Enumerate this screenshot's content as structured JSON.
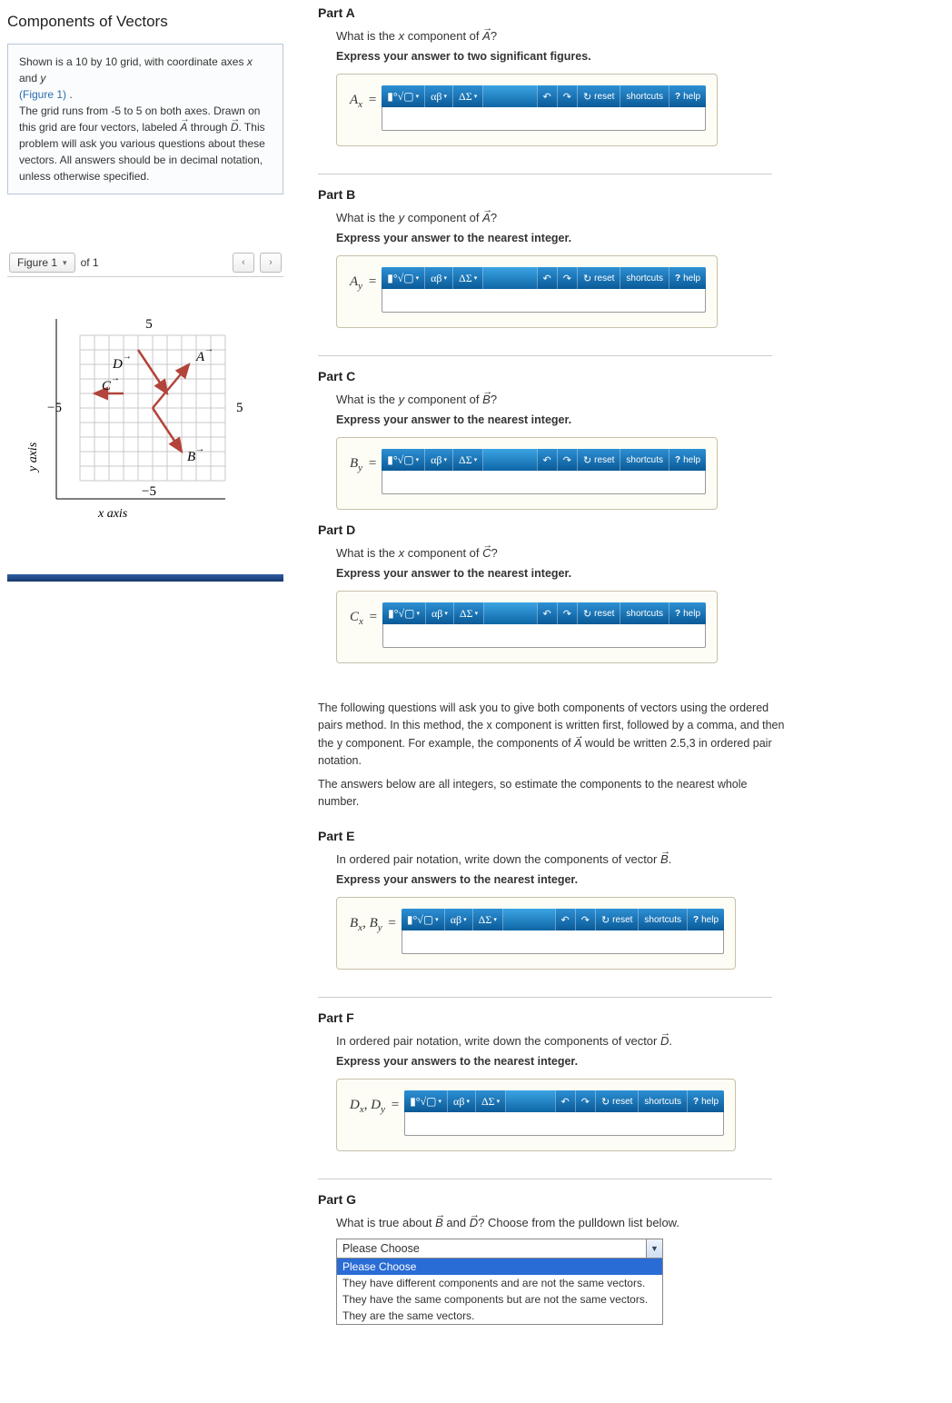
{
  "left": {
    "title": "Components of Vectors",
    "intro_p1a": "Shown is a 10 by 10 grid, with coordinate axes ",
    "intro_p1b": " and ",
    "intro_x": "x",
    "intro_y": "y",
    "figure_link": "(Figure 1)",
    "intro_p2a": "The grid runs from -5 to 5 on both axes. Drawn on this grid are four vectors, labeled ",
    "intro_p2b": " through ",
    "intro_p2c": ". This problem will ask you various questions about these vectors. All answers should be in decimal notation, unless otherwise specified.",
    "vecA": "A",
    "vecD": "D",
    "figure_selector": "Figure 1",
    "of_label": "of 1",
    "axis_x": "x axis",
    "axis_y": "y axis",
    "tick_neg5": "−5",
    "tick_5": "5",
    "lblA": "A",
    "lblB": "B",
    "lblC": "C",
    "lblD": "D"
  },
  "toolbar": {
    "t1": "▮°√▢",
    "t2": "αβ",
    "t3": "ΔΣ",
    "undo": "↶",
    "redo": "↷",
    "refresh": "↻",
    "reset": "reset",
    "shortcuts": "shortcuts",
    "help": "help",
    "qmark": "?"
  },
  "parts": {
    "A": {
      "title": "Part A",
      "q_pre": "What is the ",
      "q_var": "x",
      "q_mid": " component of ",
      "q_vec": "A",
      "q_post": "?",
      "hint": "Express your answer to two significant figures.",
      "lhs_main": "A",
      "lhs_sub": "x"
    },
    "B": {
      "title": "Part B",
      "q_pre": "What is the ",
      "q_var": "y",
      "q_mid": " component of ",
      "q_vec": "A",
      "q_post": "?",
      "hint": "Express your answer to the nearest integer.",
      "lhs_main": "A",
      "lhs_sub": "y"
    },
    "C": {
      "title": "Part C",
      "q_pre": "What is the ",
      "q_var": "y",
      "q_mid": " component of ",
      "q_vec": "B",
      "q_post": "?",
      "hint": "Express your answer to the nearest integer.",
      "lhs_main": "B",
      "lhs_sub": "y"
    },
    "D": {
      "title": "Part D",
      "q_pre": "What is the ",
      "q_var": "x",
      "q_mid": " component of ",
      "q_vec": "C",
      "q_post": "?",
      "hint": "Express your answer to the nearest integer.",
      "lhs_main": "C",
      "lhs_sub": "x"
    },
    "info1": "The following questions will ask you to give both components of vectors using the ordered pairs method. In this method, the x component is written first, followed by a comma, and then the y component. For example, the components of ",
    "info1_vec": "A",
    "info1b": " would be written 2.5,3 in ordered pair notation.",
    "info2": "The answers below are all integers, so estimate the components to the nearest whole number.",
    "E": {
      "title": "Part E",
      "q_pre": "In ordered pair notation, write down the components of vector ",
      "q_vec": "B",
      "q_post": ".",
      "hint": "Express your answers to the nearest integer.",
      "lhs_main1": "B",
      "lhs_sub1": "x",
      "lhs_main2": "B",
      "lhs_sub2": "y"
    },
    "F": {
      "title": "Part F",
      "q_pre": "In ordered pair notation, write down the components of vector ",
      "q_vec": "D",
      "q_post": ".",
      "hint": "Express your answers to the nearest integer.",
      "lhs_main1": "D",
      "lhs_sub1": "x",
      "lhs_main2": "D",
      "lhs_sub2": "y"
    },
    "G": {
      "title": "Part G",
      "q_pre": "What is true about ",
      "q_vec1": "B",
      "q_and": " and ",
      "q_vec2": "D",
      "q_post": "? Choose from the pulldown list below.",
      "selected": "Please Choose",
      "opts": [
        "Please Choose",
        "They have different components and are not the same vectors.",
        "They have the same components but are not the same vectors.",
        "They are the same vectors."
      ]
    }
  },
  "chart_data": {
    "type": "scatter",
    "title": "Vector grid",
    "xlabel": "x axis",
    "ylabel": "y axis",
    "xlim": [
      -5,
      5
    ],
    "ylim": [
      -5,
      5
    ],
    "series": [
      {
        "name": "A",
        "start": [
          0,
          0
        ],
        "end": [
          2.5,
          3
        ]
      },
      {
        "name": "B",
        "start": [
          0,
          0
        ],
        "end": [
          2,
          -3
        ]
      },
      {
        "name": "C",
        "start": [
          -2,
          1
        ],
        "end": [
          -4,
          1
        ]
      },
      {
        "name": "D",
        "start": [
          -1,
          4
        ],
        "end": [
          1,
          1
        ]
      }
    ]
  }
}
